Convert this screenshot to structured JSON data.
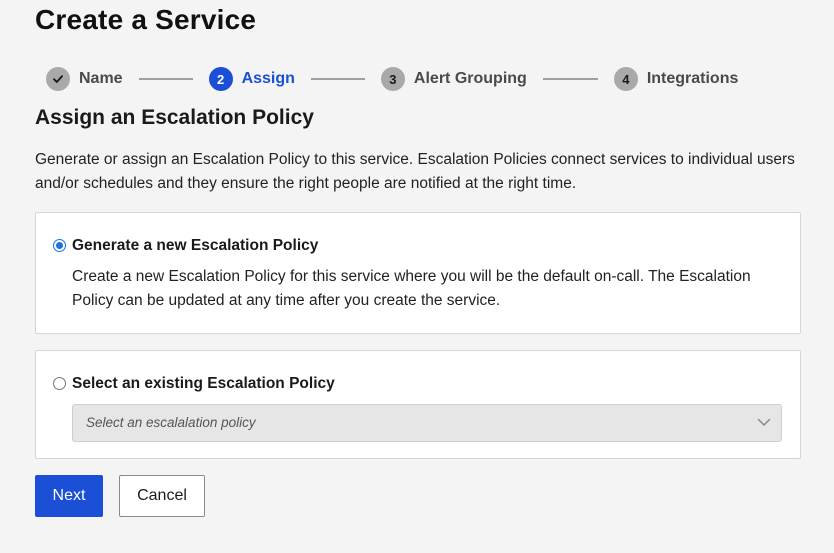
{
  "page": {
    "title": "Create a Service"
  },
  "stepper": {
    "steps": [
      {
        "number": "",
        "label": "Name",
        "state": "completed",
        "icon": "checkmark-icon"
      },
      {
        "number": "2",
        "label": "Assign",
        "state": "active"
      },
      {
        "number": "3",
        "label": "Alert Grouping",
        "state": "upcoming"
      },
      {
        "number": "4",
        "label": "Integrations",
        "state": "upcoming"
      }
    ]
  },
  "section": {
    "title": "Assign an Escalation Policy",
    "description": "Generate or assign an Escalation Policy to this service. Escalation Policies connect services to individual users and/or schedules and they ensure the right people are notified at the right time."
  },
  "options": {
    "generate": {
      "label": "Generate a new Escalation Policy",
      "description": "Create a new Escalation Policy for this service where you will be the default on-call. The Escalation Policy can be updated at any time after you create the service.",
      "selected": true
    },
    "existing": {
      "label": "Select an existing Escalation Policy",
      "selected": false,
      "select": {
        "placeholder": "Select an escalalation policy",
        "disabled": true,
        "icon": "chevron-down-icon"
      }
    }
  },
  "actions": {
    "next_label": "Next",
    "cancel_label": "Cancel"
  },
  "colors": {
    "primary": "#1a4fd6",
    "radio_accent": "#1a73e8",
    "page_background": "#f4f4f4",
    "step_inactive": "#a9a9a9"
  }
}
